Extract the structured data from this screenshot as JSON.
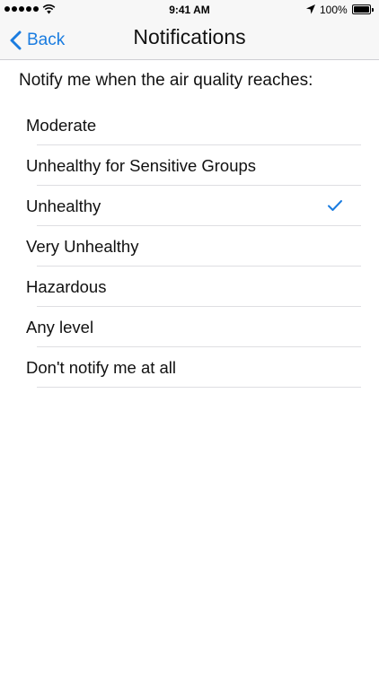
{
  "status_bar": {
    "time": "9:41 AM",
    "battery": "100%",
    "signal_icon": "signal-dots-icon",
    "wifi_icon": "wifi-icon",
    "location_icon": "location-arrow-icon",
    "battery_icon": "battery-icon"
  },
  "nav": {
    "back_label": "Back",
    "back_icon": "chevron-left-icon",
    "title": "Notifications"
  },
  "prompt": "Notify me when the air quality reaches:",
  "options": [
    {
      "label": "Moderate",
      "selected": false
    },
    {
      "label": "Unhealthy for Sensitive Groups",
      "selected": false
    },
    {
      "label": "Unhealthy",
      "selected": true
    },
    {
      "label": "Very Unhealthy",
      "selected": false
    },
    {
      "label": "Hazardous",
      "selected": false
    },
    {
      "label": "Any level",
      "selected": false
    },
    {
      "label": "Don't notify me at all",
      "selected": false
    }
  ],
  "colors": {
    "accent": "#1a7ce0",
    "bar_background": "#f7f7f7",
    "separator": "#dedee2"
  }
}
